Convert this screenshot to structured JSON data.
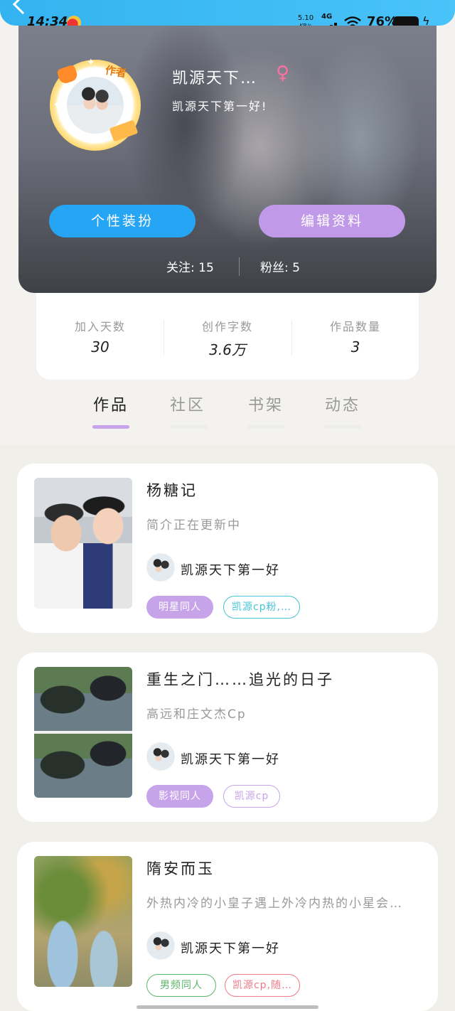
{
  "status_bar": {
    "time": "14:34",
    "net_speed_value": "5.10",
    "net_speed_unit": "KB/s",
    "net_type": "4G",
    "battery": "76%"
  },
  "profile": {
    "avatar_badge": "作者",
    "username": "凯源天下…",
    "gender": "♀",
    "signature": "凯源天下第一好!",
    "dress_button": "个性装扮",
    "edit_button": "编辑资料",
    "follow_label": "关注: 15",
    "fans_label": "粉丝: 5"
  },
  "stats": [
    {
      "label": "加入天数",
      "value": "30"
    },
    {
      "label": "创作字数",
      "value": "3.6万"
    },
    {
      "label": "作品数量",
      "value": "3"
    }
  ],
  "tabs": [
    {
      "label": "作品",
      "active": true
    },
    {
      "label": "社区",
      "active": false
    },
    {
      "label": "书架",
      "active": false
    },
    {
      "label": "动态",
      "active": false
    }
  ],
  "books": [
    {
      "title": "杨糖记",
      "desc": "简介正在更新中",
      "author": "凯源天下第一好",
      "tags": [
        {
          "text": "明星同人",
          "style": "fill",
          "color": "#c7a4ea"
        },
        {
          "text": "凯源cp粉,…",
          "style": "outline",
          "color": "#45c3d8"
        }
      ]
    },
    {
      "title": "重生之门……追光的日子",
      "desc": "高远和庄文杰Cp",
      "author": "凯源天下第一好",
      "tags": [
        {
          "text": "影视同人",
          "style": "fill",
          "color": "#c7a4ea"
        },
        {
          "text": "凯源cp",
          "style": "outline",
          "color": "#c7a4ea"
        }
      ]
    },
    {
      "title": "隋安而玉",
      "desc": "外热内冷的小皇子遇上外冷内热的小星会…",
      "author": "凯源天下第一好",
      "tags": [
        {
          "text": "男频同人",
          "style": "outline",
          "color": "#5bb66a"
        },
        {
          "text": "凯源cp,随…",
          "style": "outline",
          "color": "#ef7a86"
        }
      ]
    }
  ]
}
